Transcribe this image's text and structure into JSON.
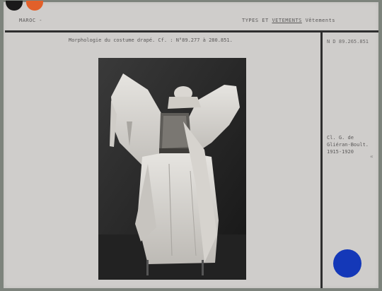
{
  "header": {
    "country": "MAROC -",
    "category_prefix": "TYPES ET ",
    "category_underlined": "VETEMENTS",
    "category_suffix": " Vêtements"
  },
  "caption": "Morphologie du costume drapé. Cf. : N°89.277 à 280.851.",
  "reference": "N D 89.265.851",
  "credit": "Cl. G. de Gliéran-Boult. 1915-1920",
  "tick_mark": "«",
  "colors": {
    "card": "#cfcdcb",
    "border": "#7d837c",
    "accent_blue": "#1438b8",
    "accent_orange": "#e2602a"
  }
}
